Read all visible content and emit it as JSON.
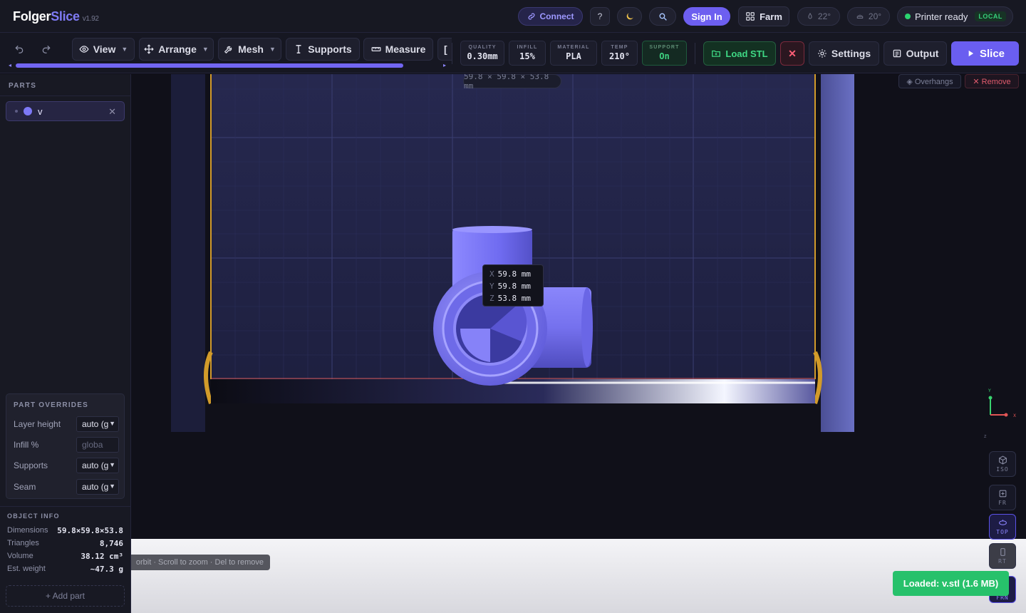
{
  "app": {
    "name_plain": "Folger",
    "name_accent": "Slice",
    "version": "v1.92"
  },
  "header": {
    "connect_label": "Connect",
    "help_label": "?",
    "theme_icon": "moon-icon",
    "search_icon": "search-icon",
    "signin_label": "Sign In",
    "farm_label": "Farm",
    "nozzle_temp": "22°",
    "bed_temp": "20°",
    "status_text": "Printer ready",
    "status_badge": "LOCAL",
    "status_color": "#2bd36f"
  },
  "toolbar": {
    "view_label": "View",
    "arrange_label": "Arrange",
    "mesh_label": "Mesh",
    "supports_label": "Supports",
    "measure_label": "Measure",
    "more_label": "[",
    "scroll_left": "◂",
    "scroll_right": "▸",
    "params": {
      "quality": {
        "label": "QUALITY",
        "value": "0.30mm"
      },
      "infill": {
        "label": "INFILL",
        "value": "15%"
      },
      "material": {
        "label": "MATERIAL",
        "value": "PLA"
      },
      "temp": {
        "label": "TEMP",
        "value": "210°"
      },
      "support": {
        "label": "SUPPORT",
        "value": "On"
      }
    },
    "load_stl_label": "Load STL",
    "close_label": "✕",
    "settings_label": "Settings",
    "output_label": "Output",
    "slice_label": "Slice",
    "accent_color": "#6a5ef0"
  },
  "sidebar": {
    "parts_title": "PARTS",
    "parts": [
      {
        "name": "v",
        "color": "#7d79f6",
        "remove": "✕"
      }
    ],
    "overrides": {
      "title": "PART OVERRIDES",
      "rows": [
        {
          "label": "Layer height",
          "value": "auto (g"
        },
        {
          "label": "Infill %",
          "placeholder": "globa"
        },
        {
          "label": "Supports",
          "value": "auto (g"
        },
        {
          "label": "Seam",
          "value": "auto (g"
        }
      ]
    },
    "object_info": {
      "title": "OBJECT INFO",
      "rows": [
        {
          "label": "Dimensions",
          "value": "59.8×59.8×53.8"
        },
        {
          "label": "Triangles",
          "value": "8,746"
        },
        {
          "label": "Volume",
          "value": "38.12 cm³"
        },
        {
          "label": "Est. weight",
          "value": "~47.3 g"
        }
      ]
    },
    "add_part_label": "+ Add part"
  },
  "viewport": {
    "dims_label": "59.8 × 59.8 × 53.8 mm",
    "overhangs_label": "◈ Overhangs",
    "remove_label": "✕ Remove",
    "tooltip": {
      "x_label": "X",
      "x_value": "59.8 mm",
      "y_label": "Y",
      "y_value": "59.8 mm",
      "z_label": "Z",
      "z_value": "53.8 mm"
    },
    "hint": "orbit · Scroll to zoom · Del to remove",
    "axes": {
      "x": "X",
      "y": "Y",
      "z": "Z"
    },
    "view_buttons": [
      {
        "label": "ISO",
        "active": false
      },
      {
        "label": "FR",
        "active": false
      },
      {
        "label": "TOP",
        "active": true
      },
      {
        "label": "RT",
        "active": false
      },
      {
        "label": "FRN",
        "active": true
      }
    ],
    "toast": "Loaded: v.stl (1.6 MB)",
    "bed_frame_color": "#d29b2a",
    "model_color": "#7d79f6"
  }
}
